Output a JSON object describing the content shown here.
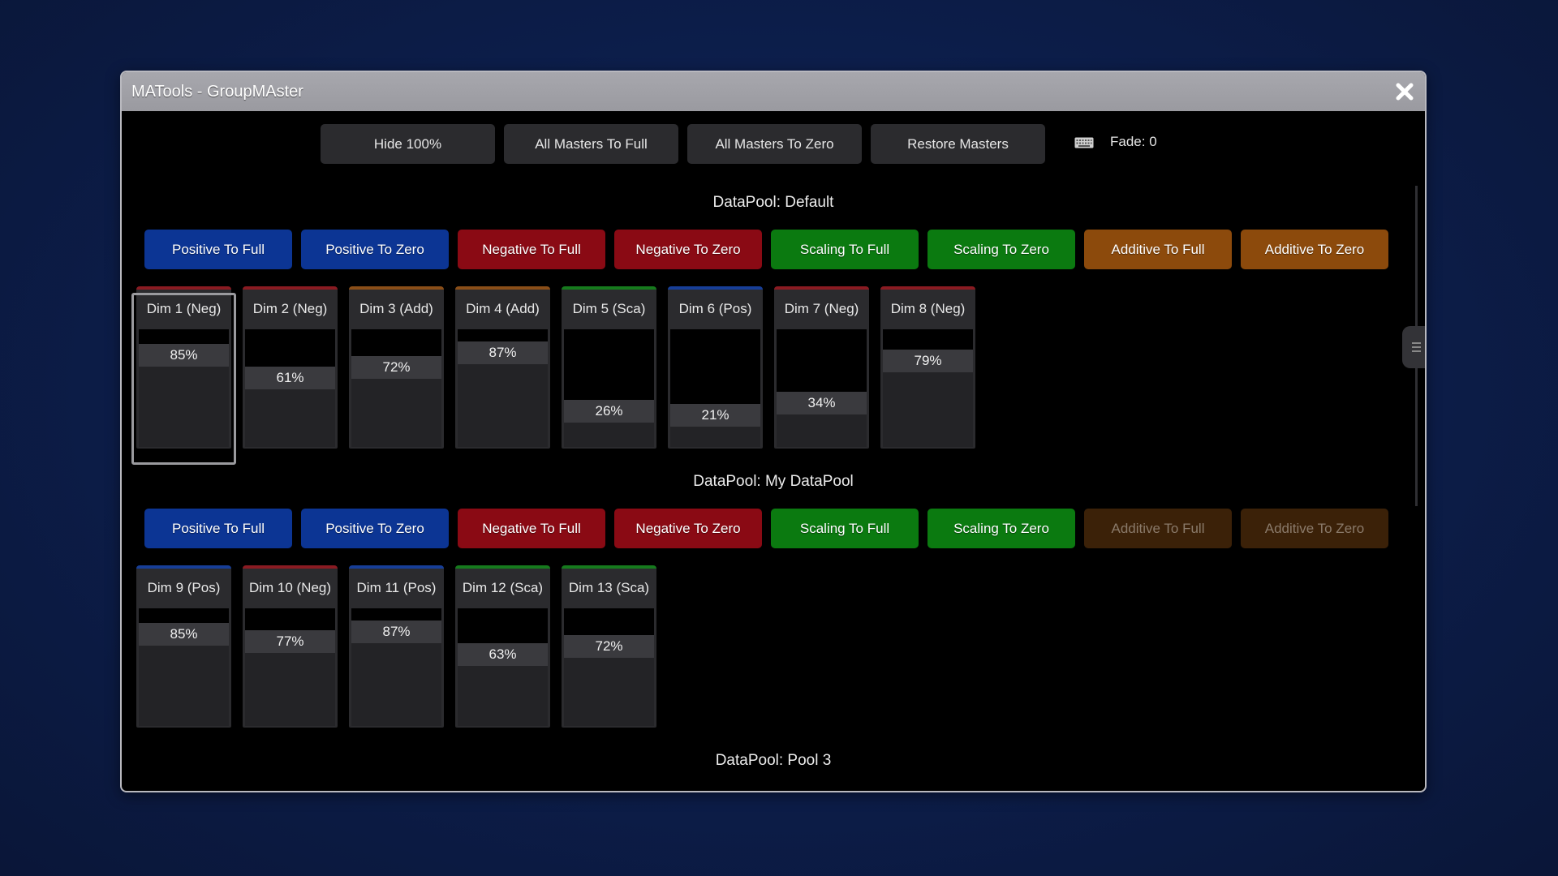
{
  "window": {
    "title": "MATools - GroupMAster"
  },
  "toolbar": {
    "buttons": [
      "Hide 100%",
      "All Masters To Full",
      "All Masters To Zero",
      "Restore Masters"
    ],
    "fade_label": "Fade: 0"
  },
  "pools": [
    {
      "title": "DataPool: Default",
      "buttons": [
        {
          "label": "Positive To Full",
          "style": "pos"
        },
        {
          "label": "Positive To Zero",
          "style": "pos"
        },
        {
          "label": "Negative To Full",
          "style": "neg"
        },
        {
          "label": "Negative To Zero",
          "style": "neg"
        },
        {
          "label": "Scaling To Full",
          "style": "sca"
        },
        {
          "label": "Scaling To Zero",
          "style": "sca"
        },
        {
          "label": "Additive To Full",
          "style": "add"
        },
        {
          "label": "Additive To Zero",
          "style": "add"
        }
      ],
      "faders": [
        {
          "label": "Dim 1 (Neg)",
          "value": "85%",
          "level": 0.85,
          "mode": "neg",
          "selected": true
        },
        {
          "label": "Dim 2 (Neg)",
          "value": "61%",
          "level": 0.61,
          "mode": "neg"
        },
        {
          "label": "Dim 3 (Add)",
          "value": "72%",
          "level": 0.72,
          "mode": "add"
        },
        {
          "label": "Dim 4 (Add)",
          "value": "87%",
          "level": 0.87,
          "mode": "add"
        },
        {
          "label": "Dim 5 (Sca)",
          "value": "26%",
          "level": 0.26,
          "mode": "sca"
        },
        {
          "label": "Dim 6 (Pos)",
          "value": "21%",
          "level": 0.21,
          "mode": "pos"
        },
        {
          "label": "Dim 7 (Neg)",
          "value": "34%",
          "level": 0.34,
          "mode": "neg"
        },
        {
          "label": "Dim 8 (Neg)",
          "value": "79%",
          "level": 0.79,
          "mode": "neg"
        }
      ]
    },
    {
      "title": "DataPool: My DataPool",
      "buttons": [
        {
          "label": "Positive To Full",
          "style": "pos"
        },
        {
          "label": "Positive To Zero",
          "style": "pos"
        },
        {
          "label": "Negative To Full",
          "style": "neg"
        },
        {
          "label": "Negative To Zero",
          "style": "neg"
        },
        {
          "label": "Scaling To Full",
          "style": "sca"
        },
        {
          "label": "Scaling To Zero",
          "style": "sca"
        },
        {
          "label": "Additive To Full",
          "style": "add-dim"
        },
        {
          "label": "Additive To Zero",
          "style": "add-dim"
        }
      ],
      "faders": [
        {
          "label": "Dim 9 (Pos)",
          "value": "85%",
          "level": 0.85,
          "mode": "pos"
        },
        {
          "label": "Dim 10 (Neg)",
          "value": "77%",
          "level": 0.77,
          "mode": "neg"
        },
        {
          "label": "Dim 11 (Pos)",
          "value": "87%",
          "level": 0.87,
          "mode": "pos"
        },
        {
          "label": "Dim 12 (Sca)",
          "value": "63%",
          "level": 0.63,
          "mode": "sca"
        },
        {
          "label": "Dim 13 (Sca)",
          "value": "72%",
          "level": 0.72,
          "mode": "sca"
        }
      ]
    },
    {
      "title": "DataPool: Pool 3",
      "buttons": [],
      "faders": []
    }
  ],
  "colors": {
    "positive": "#0c3594",
    "negative": "#8a0a14",
    "scaling": "#0b7a10",
    "additive": "#8c4a0c",
    "additive_disabled": "#3b2108"
  },
  "icons": {
    "close": "close-icon",
    "keyboard": "keyboard-icon"
  }
}
